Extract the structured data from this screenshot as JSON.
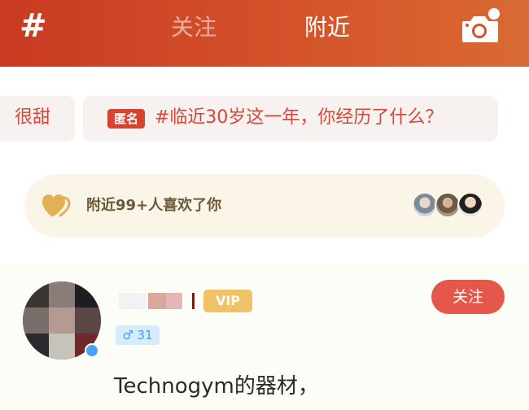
{
  "header": {
    "hash_glyph": "#",
    "tabs": [
      {
        "label": "关注",
        "active": false
      },
      {
        "label": "附近",
        "active": true
      }
    ],
    "colors": {
      "gradient_start": "#c83a22",
      "gradient_end": "#d96a33"
    }
  },
  "topics": {
    "partial_chip_text": "很甜",
    "main_chip": {
      "badge": "匿名",
      "text": "#临近30岁这一年，你经历了什么？"
    }
  },
  "likes_banner": {
    "text": "附近99+人喜欢了你",
    "avatars": [
      "avatar-1",
      "avatar-2",
      "avatar-3"
    ]
  },
  "post": {
    "vip_label": "VIP",
    "gender_age": "♂ 31",
    "follow_label": "关注",
    "content": "Technogym的器材，"
  }
}
